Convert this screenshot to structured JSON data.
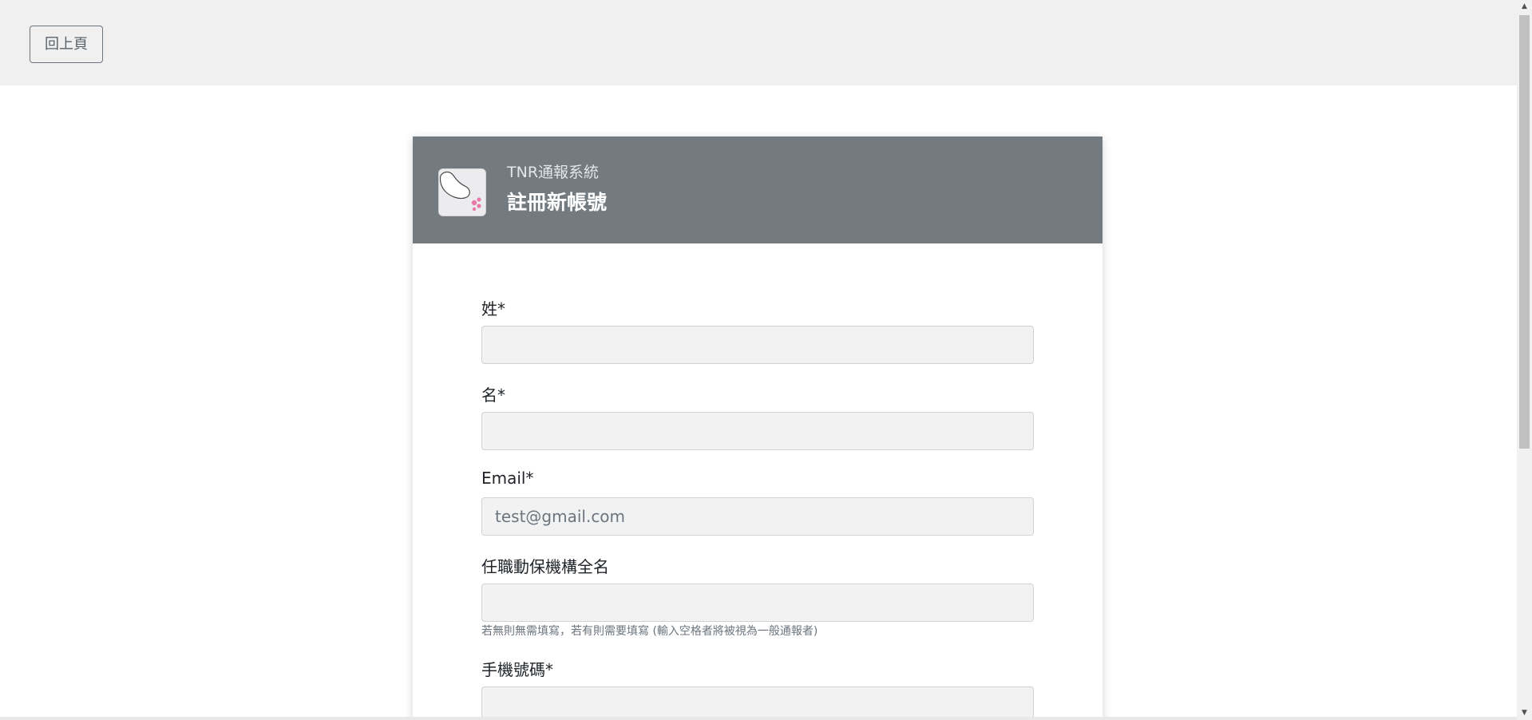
{
  "top_bar": {
    "back_label": "回上頁"
  },
  "header": {
    "app_name": "TNR通報系統",
    "page_title": "註冊新帳號"
  },
  "form": {
    "last_name": {
      "label": "姓*",
      "value": "",
      "placeholder": ""
    },
    "first_name": {
      "label": "名*",
      "value": "",
      "placeholder": ""
    },
    "email": {
      "label": "Email*",
      "value": "",
      "placeholder": "test@gmail.com"
    },
    "organization": {
      "label": "任職動保機構全名",
      "value": "",
      "placeholder": "",
      "help": "若無則無需填寫，若有則需要填寫 (輸入空格者將被視為一般通報者)"
    },
    "phone": {
      "label": "手機號碼*",
      "value": "",
      "placeholder": ""
    }
  },
  "icons": {
    "logo": "cat-paw-logo-icon",
    "scroll_up": "chevron-up-icon",
    "scroll_down": "chevron-down-icon"
  },
  "colors": {
    "header_bg": "#737b80",
    "top_bar_bg": "#f0f0f0",
    "input_bg": "#f2f2f2",
    "logo_accent": "#e879a8"
  }
}
